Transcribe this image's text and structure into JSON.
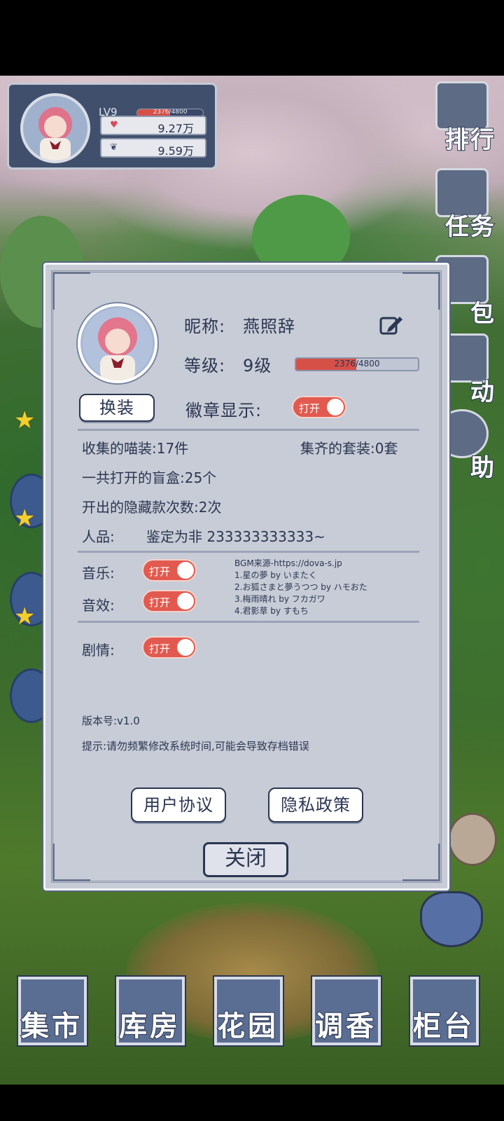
{
  "hud": {
    "level": "LV9",
    "exp_text": "2376/4800",
    "exp_fraction": 0.495,
    "currency1": "9.27万",
    "currency2": "9.59万"
  },
  "side_menu": [
    {
      "label": "排行",
      "icon": "ranking-icon"
    },
    {
      "label": "任务",
      "icon": "task-scroll-icon"
    },
    {
      "label": "包",
      "icon": "bag-icon"
    },
    {
      "label": "动",
      "icon": "activity-icon"
    },
    {
      "label": "助",
      "icon": "help-icon"
    }
  ],
  "profile": {
    "nickname_label": "昵称:",
    "nickname": "燕照辞",
    "level_label": "等级:",
    "level_value": "9级",
    "exp_text": "2376/4800",
    "exp_fraction": 0.495,
    "dress_button": "换装",
    "badge_label": "徽章显示:",
    "toggle_on": "打开",
    "stats": {
      "collected": "收集的喵装:17件",
      "sets": "集齐的套装:0套",
      "boxes": "一共打开的盲盒:25个",
      "hidden": "开出的隐藏款次数:2次",
      "luck_label": "人品:",
      "luck_value": "鉴定为非 233333333333~"
    },
    "music_label": "音乐:",
    "sfx_label": "音效:",
    "story_label": "剧情:",
    "bgm_credits": [
      "BGM来源-https://dova-s.jp",
      "1.星の夢 by いまたく",
      "2.お狐さまと夢うつつ by ハモおた",
      "3.梅雨晴れ by フカガワ",
      "4.君影草 by すもち"
    ],
    "version": "版本号:v1.0",
    "tip": "提示:请勿频繁修改系统时间,可能会导致存档错误",
    "user_agreement": "用户协议",
    "privacy_policy": "隐私政策",
    "close": "关闭"
  },
  "bottom_nav": [
    {
      "label": "集市",
      "icon": "market-gate-icon"
    },
    {
      "label": "库房",
      "icon": "warehouse-icon"
    },
    {
      "label": "花园",
      "icon": "rose-icon"
    },
    {
      "label": "调香",
      "icon": "perfume-icon"
    },
    {
      "label": "柜台",
      "icon": "counter-icon"
    }
  ],
  "colors": {
    "accent_red": "#e25a4f",
    "navy": "#2b3652",
    "panel": "#c8ccd6"
  }
}
